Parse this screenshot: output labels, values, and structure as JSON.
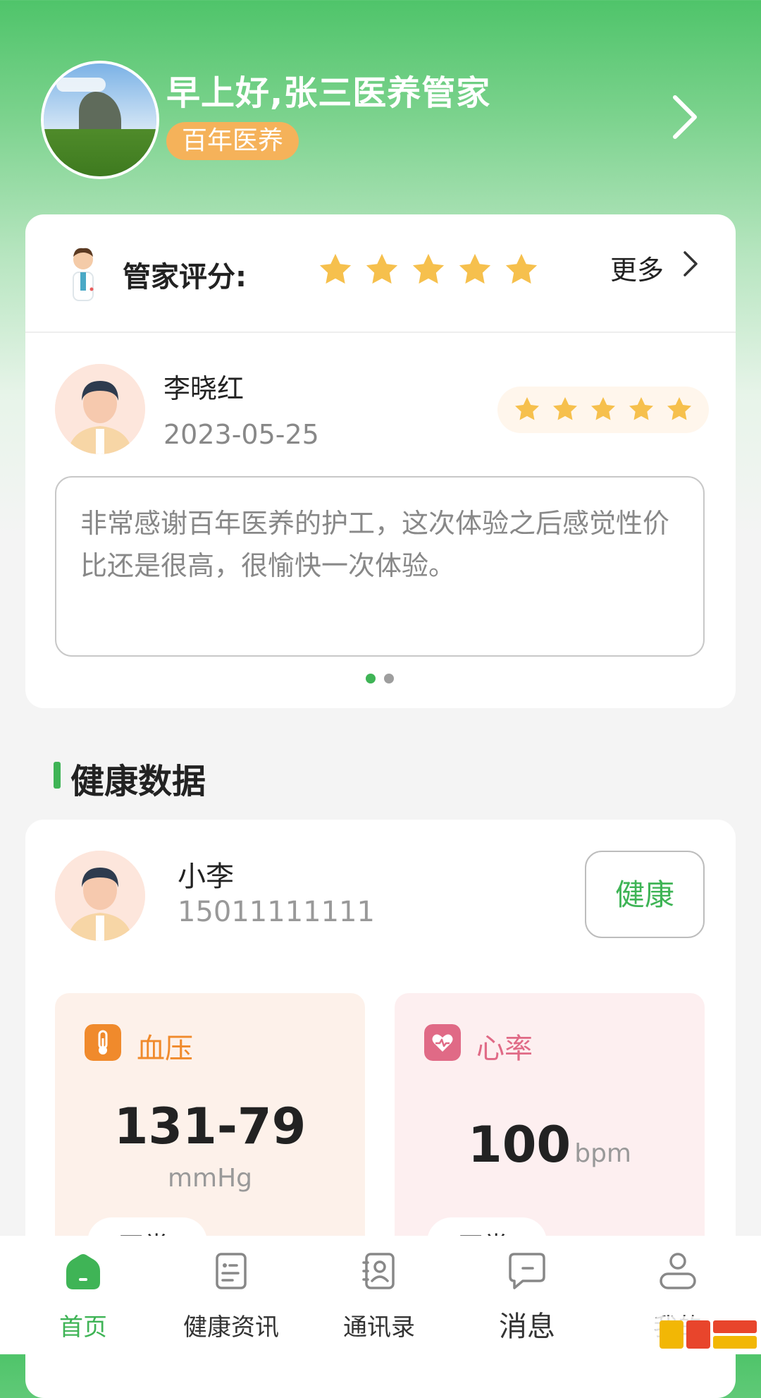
{
  "header": {
    "greeting": "早上好,张三医养管家",
    "badge": "百年医养"
  },
  "rating_card": {
    "label": "管家评分:",
    "star_count": 5,
    "more_label": "更多",
    "review": {
      "name": "李晓红",
      "date": "2023-05-25",
      "stars": 5,
      "comment": "非常感谢百年医养的护工，这次体验之后感觉性价比还是很高，很愉快一次体验。"
    },
    "carousel": {
      "pages": 2,
      "active": 1
    }
  },
  "health_section": {
    "title": "健康数据",
    "user": {
      "name": "小李",
      "phone": "15011111111"
    },
    "status_button": "健康",
    "metrics": [
      {
        "label": "血压",
        "value": "131-79",
        "unit": "mmHg",
        "status": "正常",
        "color": "#f08a2c"
      },
      {
        "label": "心率",
        "value": "100",
        "unit": "bpm",
        "status": "正常",
        "color": "#e06a86"
      }
    ]
  },
  "bottom_nav": {
    "items": [
      {
        "label": "首页",
        "icon": "home-icon",
        "active": true
      },
      {
        "label": "健康资讯",
        "icon": "news-icon",
        "active": false
      },
      {
        "label": "通讯录",
        "icon": "contacts-icon",
        "active": false
      },
      {
        "label": "消息",
        "icon": "message-icon",
        "active": false
      },
      {
        "label": "我的",
        "icon": "profile-icon",
        "active": false
      }
    ]
  },
  "colors": {
    "brand_green": "#3fb456",
    "badge_orange": "#f5b25a",
    "star_gold": "#f6c04d"
  }
}
